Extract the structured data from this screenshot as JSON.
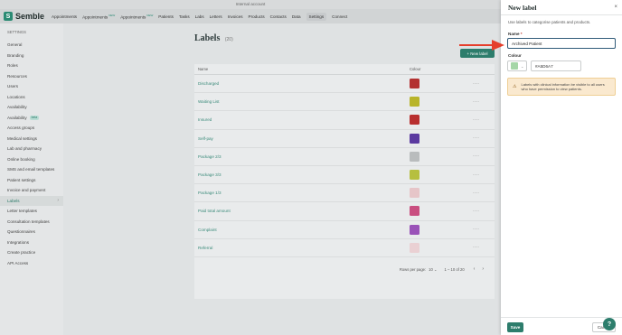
{
  "internal_bar": {
    "text": "Internal account"
  },
  "brand": {
    "logo_letter": "S",
    "name": "Semble"
  },
  "topnav": {
    "items": [
      {
        "label": "Appointments",
        "badge": ""
      },
      {
        "label": "Appointments",
        "badge": "NEW"
      },
      {
        "label": "Appointments",
        "badge": "NEW"
      },
      {
        "label": "Patients",
        "badge": ""
      },
      {
        "label": "Tasks",
        "badge": ""
      },
      {
        "label": "Labs",
        "badge": ""
      },
      {
        "label": "Letters",
        "badge": ""
      },
      {
        "label": "Invoices",
        "badge": ""
      },
      {
        "label": "Products",
        "badge": ""
      },
      {
        "label": "Contacts",
        "badge": ""
      },
      {
        "label": "Data",
        "badge": ""
      },
      {
        "label": "Settings",
        "badge": ""
      },
      {
        "label": "Connect",
        "badge": ""
      }
    ],
    "active": "Settings"
  },
  "sidebar": {
    "heading": "SETTINGS",
    "items": [
      {
        "label": "General"
      },
      {
        "label": "Branding"
      },
      {
        "label": "Roles"
      },
      {
        "label": "Resources"
      },
      {
        "label": "Users"
      },
      {
        "label": "Locations"
      },
      {
        "label": "Availability"
      },
      {
        "label": "Availability",
        "badge": "beta"
      },
      {
        "label": "Access groups"
      },
      {
        "label": "Medical settings"
      },
      {
        "label": "Lab and pharmacy"
      },
      {
        "label": "Online booking"
      },
      {
        "label": "SMS and email templates"
      },
      {
        "label": "Patient settings"
      },
      {
        "label": "Invoice and payment"
      },
      {
        "label": "Labels",
        "active": true,
        "chevron": "›"
      },
      {
        "label": "Letter templates"
      },
      {
        "label": "Consultation templates"
      },
      {
        "label": "Questionnaires"
      },
      {
        "label": "Integrations"
      },
      {
        "label": "Create practice"
      },
      {
        "label": "API Access"
      }
    ]
  },
  "page": {
    "title": "Labels",
    "count": "(20)",
    "new_label_button": "+ New label"
  },
  "table": {
    "headers": {
      "name": "Name",
      "colour": "Colour"
    },
    "menu_glyph": "···",
    "rows": [
      {
        "name": "Discharged",
        "colour": "#b33131"
      },
      {
        "name": "Waiting List",
        "colour": "#b8b42a"
      },
      {
        "name": "Insured",
        "colour": "#b82f2f"
      },
      {
        "name": "Self-pay",
        "colour": "#5b3aa0"
      },
      {
        "name": "Package 2/3",
        "colour": "#b9bcbd"
      },
      {
        "name": "Package 3/3",
        "colour": "#b6bf3f"
      },
      {
        "name": "Package 1/3",
        "colour": "#e6c5c8"
      },
      {
        "name": "Paid total amount",
        "colour": "#c94e80"
      },
      {
        "name": "Complaint",
        "colour": "#9a52b8"
      },
      {
        "name": "Referral",
        "colour": "#ead0d3"
      }
    ]
  },
  "pagination": {
    "rows_per_page_label": "Rows per page:",
    "rows_per_page_value": "10",
    "rows_chevron": "⌄",
    "range": "1 – 10 of 20",
    "prev_arrow": "‹",
    "next_arrow": "›"
  },
  "drawer": {
    "title": "New label",
    "close": "×",
    "description": "Use labels to categorise patients and products.",
    "name_label": "Name",
    "required_mark": "*",
    "name_value": "Archived Patient",
    "colour_label": "Colour",
    "colour_value": "#A5D6A7",
    "colour_chevron": "⌄",
    "warning_icon": "⚠",
    "warning_text": "Labels with clinical information be visible to all users who have permission to view patients.",
    "save_button": "Save",
    "cancel_button": "Cancel"
  },
  "help_button": {
    "label": "?"
  },
  "colors": {
    "accent": "#2d7d6c",
    "annotation_arrow": "#e53e2b",
    "warning_bg": "#fae9cf"
  }
}
